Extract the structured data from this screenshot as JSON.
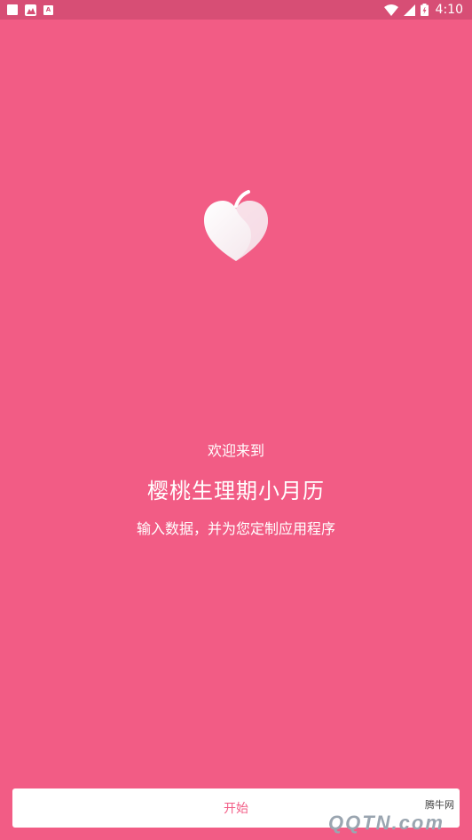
{
  "status_bar": {
    "time": "4:10",
    "left_icons": [
      "square-icon",
      "image-icon",
      "a-icon"
    ],
    "right_icons": [
      "wifi-icon",
      "signal-icon",
      "battery-icon"
    ]
  },
  "welcome": {
    "greeting": "欢迎来到",
    "app_name": "樱桃生理期小月历",
    "description": "输入数据，并为您定制应用程序"
  },
  "start_button": {
    "label": "开始"
  },
  "watermark": {
    "text": "腾牛网",
    "logo_text": "QQTN.com"
  },
  "colors": {
    "background": "#F25C85",
    "status_bar": "#D74E75",
    "button_bg": "#FFFFFF",
    "button_text": "#F25C85"
  }
}
